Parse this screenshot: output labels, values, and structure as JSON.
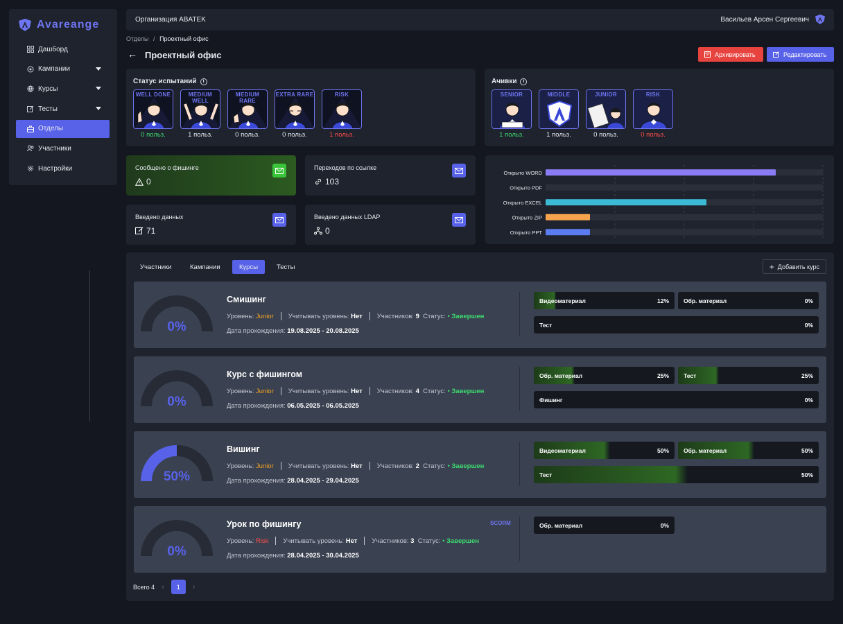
{
  "brand": {
    "name": "Avareange",
    "logo_icon": "avareange-logo-icon"
  },
  "sidebar": {
    "items": [
      {
        "label": "Дашборд",
        "icon": "grid-icon"
      },
      {
        "label": "Кампании",
        "icon": "target-icon"
      },
      {
        "label": "Курсы",
        "icon": "globe-icon"
      },
      {
        "label": "Тесты",
        "icon": "edit-icon"
      },
      {
        "label": "Отделы",
        "icon": "building-icon"
      },
      {
        "label": "Участники",
        "icon": "users-icon"
      },
      {
        "label": "Настройки",
        "icon": "gear-icon"
      }
    ]
  },
  "topbar": {
    "org": "Организация ABATEK",
    "user": "Васильев Арсен Сергеевич"
  },
  "breadcrumb": {
    "parent": "Отделы",
    "separator": "/",
    "current": "Проектный офис"
  },
  "page": {
    "title": "Проектный офис",
    "archive_label": "Архивировать",
    "edit_label": "Редактировать"
  },
  "test_status": {
    "title": "Статус испытаний",
    "badges": [
      {
        "tag": "WELL DONE",
        "count": "0 польз.",
        "color": "#3ddc70"
      },
      {
        "tag": "MEDIUM WELL",
        "count": "1 польз.",
        "color": "#e6e8ee"
      },
      {
        "tag": "MEDIUM RARE",
        "count": "0 польз.",
        "color": "#e6e8ee"
      },
      {
        "tag": "EXTRA RARE",
        "count": "0 польз.",
        "color": "#e6e8ee"
      },
      {
        "tag": "RISK",
        "count": "1 польз.",
        "color": "#ff4d4d"
      }
    ]
  },
  "achievements": {
    "title": "Ачивки",
    "badges": [
      {
        "tag": "SENIOR",
        "count": "1 польз.",
        "color": "#3ddc70"
      },
      {
        "tag": "MIDDLE",
        "count": "1 польз.",
        "color": "#e6e8ee"
      },
      {
        "tag": "JUNIOR",
        "count": "0 польз.",
        "color": "#e6e8ee"
      },
      {
        "tag": "RISK",
        "count": "0 польз.",
        "color": "#ff4d4d"
      }
    ]
  },
  "stats": [
    {
      "label": "Сообщено о фишинге",
      "value": "0",
      "icon": "warning-icon"
    },
    {
      "label": "Переходов по ссылке",
      "value": "103",
      "icon": "link-icon"
    },
    {
      "label": "Введено данных",
      "value": "71",
      "icon": "edit-icon"
    },
    {
      "label": "Введено данных LDAP",
      "value": "0",
      "icon": "tree-icon"
    }
  ],
  "chart_data": {
    "type": "bar",
    "orientation": "horizontal",
    "categories": [
      "Открыто WORD",
      "Открыто PDF",
      "Открыто EXCEL",
      "Открыто ZIP",
      "Открыто PPT"
    ],
    "values": [
      83,
      0,
      58,
      16,
      16
    ],
    "colors": [
      "#8b7cf6",
      "#5862e8",
      "#3bbad6",
      "#f5a44d",
      "#5b7bf0"
    ],
    "xlim": [
      0,
      100
    ],
    "grid": true
  },
  "tabs": {
    "items": [
      "Участники",
      "Кампании",
      "Курсы",
      "Тесты"
    ],
    "active": 2,
    "add_label": "Добавить курс"
  },
  "courses": [
    {
      "title": "Смишинг",
      "progress": 0,
      "progress_label": "0%",
      "level_label": "Уровень:",
      "level": "Junior",
      "level_color": "#f5a623",
      "consider_label": "Учитывать уровень:",
      "consider": "Нет",
      "participants_label": "Участников:",
      "participants": "9",
      "status_label": "Статус:",
      "status": "Завершен",
      "date_label": "Дата прохождения:",
      "date": "19.08.2025 - 20.08.2025",
      "scorm": "",
      "bars": [
        {
          "label": "Видеоматериал",
          "value": "12%",
          "fill": 0.12
        },
        {
          "label": "Обр. материал",
          "value": "0%",
          "fill": 0
        },
        {
          "label": "Тест",
          "value": "0%",
          "fill": 0
        }
      ]
    },
    {
      "title": "Курс с фишингом",
      "progress": 0,
      "progress_label": "0%",
      "level_label": "Уровень:",
      "level": "Junior",
      "level_color": "#f5a623",
      "consider_label": "Учитывать уровень:",
      "consider": "Нет",
      "participants_label": "Участников:",
      "participants": "4",
      "status_label": "Статус:",
      "status": "Завершен",
      "date_label": "Дата прохождения:",
      "date": "06.05.2025 - 06.05.2025",
      "scorm": "",
      "bars": [
        {
          "label": "Обр. материал",
          "value": "25%",
          "fill": 0.25
        },
        {
          "label": "Тест",
          "value": "25%",
          "fill": 0.25
        },
        {
          "label": "Фишинг",
          "value": "0%",
          "fill": 0
        }
      ]
    },
    {
      "title": "Вишинг",
      "progress": 50,
      "progress_label": "50%",
      "level_label": "Уровень:",
      "level": "Junior",
      "level_color": "#f5a623",
      "consider_label": "Учитывать уровень:",
      "consider": "Нет",
      "participants_label": "Участников:",
      "participants": "2",
      "status_label": "Статус:",
      "status": "Завершен",
      "date_label": "Дата прохождения:",
      "date": "28.04.2025 - 29.04.2025",
      "scorm": "",
      "bars": [
        {
          "label": "Видеоматериал",
          "value": "50%",
          "fill": 0.5
        },
        {
          "label": "Обр. материал",
          "value": "50%",
          "fill": 0.5
        },
        {
          "label": "Тест",
          "value": "50%",
          "fill": 0.5
        }
      ]
    },
    {
      "title": "Урок по фишингу",
      "progress": 0,
      "progress_label": "0%",
      "level_label": "Уровень:",
      "level": "Risk",
      "level_color": "#ff4d4d",
      "consider_label": "Учитывать уровень:",
      "consider": "Нет",
      "participants_label": "Участников:",
      "participants": "3",
      "status_label": "Статус:",
      "status": "Завершен",
      "date_label": "Дата прохождения:",
      "date": "28.04.2025 - 30.04.2025",
      "scorm": "SCORM",
      "bars": [
        {
          "label": "Обр. материал",
          "value": "0%",
          "fill": 0
        }
      ]
    }
  ],
  "pagination": {
    "total": "Всего 4",
    "current": "1"
  },
  "colors": {
    "accent": "#5862e8",
    "success": "#3ddc70",
    "danger": "#e8443f",
    "panel": "#1f232d"
  }
}
